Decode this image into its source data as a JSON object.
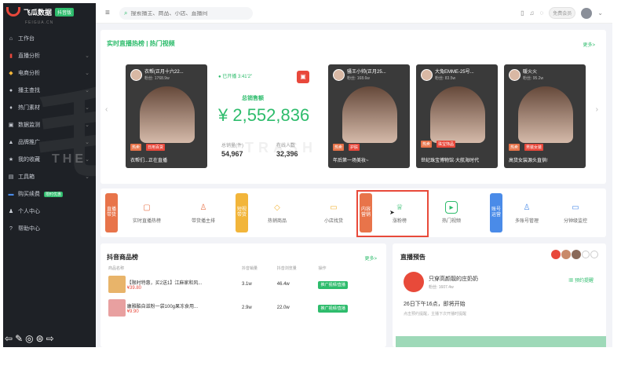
{
  "brand": {
    "name": "飞瓜数据",
    "badge": "抖音版",
    "sub": "FEIGUA.CN",
    "accent": "#2ebc6c",
    "danger": "#e8483b"
  },
  "sidebar": {
    "items": [
      {
        "label": "工作台",
        "icon": "home-icon"
      },
      {
        "label": "直播分析",
        "icon": "bar-chart-icon"
      },
      {
        "label": "电商分析",
        "icon": "bag-icon"
      },
      {
        "label": "播主查找",
        "icon": "person-search-icon"
      },
      {
        "label": "热门素材",
        "icon": "fire-icon"
      },
      {
        "label": "数据监测",
        "icon": "monitor-icon"
      },
      {
        "label": "品牌推广",
        "icon": "brand-icon"
      },
      {
        "label": "我的收藏",
        "icon": "star-icon"
      },
      {
        "label": "工具箱",
        "icon": "toolbox-icon"
      },
      {
        "label": "购买续费",
        "icon": "card-icon",
        "badge": "限时优惠"
      },
      {
        "label": "个人中心",
        "icon": "user-icon"
      },
      {
        "label": "帮助中心",
        "icon": "help-icon"
      }
    ],
    "watermark": "THE"
  },
  "topbar": {
    "search_placeholder": "搜索播主、商品、小店、直播间",
    "member_label": "免费会员"
  },
  "live_section": {
    "title": "实时直播热榜 | 热门视频",
    "more": "更多>",
    "cards": [
      {
        "name": "衣帮(正月十六22...",
        "fans": "粉丝: 1768.9w",
        "tag1": "热卖",
        "tag2": "日用百货",
        "footer": "衣帮们...正在直播"
      },
      {
        "name": "骚王小帅(正月25...",
        "fans": "粉丝: 168.6w",
        "tag1": "热卖",
        "tag2": "护肤",
        "footer": "年后第一场美妆~"
      },
      {
        "name": "大兔EMME-25号...",
        "fans": "粉丝: 83.5w",
        "tag1": "热卖",
        "tag2": "珠宝饰品",
        "footer": "世纪珠宝博物馆·大航海时代"
      },
      {
        "name": "暖火火",
        "fans": "粉丝: 95.2w",
        "tag1": "热卖",
        "tag2": "男装女装",
        "footer": "高货女装源头直供!"
      }
    ],
    "gmv": {
      "status": "● 已开播 3:41'2\"",
      "label": "总销售额",
      "value": "¥ 2,552,836",
      "sales_label": "总销量(件)",
      "sales_value": "54,967",
      "online_label": "在线人数",
      "online_value": "32,396"
    },
    "watermark": "TRASH"
  },
  "quick_access": {
    "groups": [
      {
        "label": "直播带货",
        "color": "#e8744a"
      },
      {
        "label": "短视带货",
        "color": "#f2b53a"
      },
      {
        "label": "内容营销",
        "color": "#e8744a"
      },
      {
        "label": "账号运营",
        "color": "#4a8be8"
      }
    ],
    "items": [
      {
        "label": "实时直播热榜",
        "icon": "tv-icon",
        "color": "#e8744a"
      },
      {
        "label": "带货播主排",
        "icon": "person-icon",
        "color": "#e8744a"
      },
      {
        "label": "热销商品",
        "icon": "bag-icon",
        "color": "#f2b53a"
      },
      {
        "label": "小店找货",
        "icon": "shop-icon",
        "color": "#f2b53a"
      },
      {
        "label": "涨粉榜",
        "icon": "trophy-icon",
        "color": "#2ebc6c"
      },
      {
        "label": "热门视频",
        "icon": "play-icon",
        "color": "#2ebc6c"
      },
      {
        "label": "多账号管理",
        "icon": "users-icon",
        "color": "#4a8be8"
      },
      {
        "label": "分钟级监控",
        "icon": "monitor-icon",
        "color": "#4a8be8"
      }
    ]
  },
  "products": {
    "title": "抖音商品榜",
    "more": "更多>",
    "columns": [
      "商品名称",
      "抖音销量",
      "抖音浏览量",
      "操作"
    ],
    "rows": [
      {
        "name": "【限时特惠，买2送1】江麻家和风...",
        "price": "¥39.80",
        "sales": "3.1w",
        "views": "46.4w",
        "action": "推广视频/直播"
      },
      {
        "name": "康雅酷自滋粉一袋100g果冻食用...",
        "price": "¥9.90",
        "sales": "2.9w",
        "views": "22.0w",
        "action": "推广视频/直播"
      }
    ]
  },
  "preview": {
    "title": "直播预告",
    "anchor": "只穿高颜靓的庄奶奶",
    "fans": "粉丝: 1607.4w",
    "time": "26日下午16点，即将开始",
    "note": "点击预约提醒，主播下次开播时提醒",
    "remind": "预约提醒"
  }
}
